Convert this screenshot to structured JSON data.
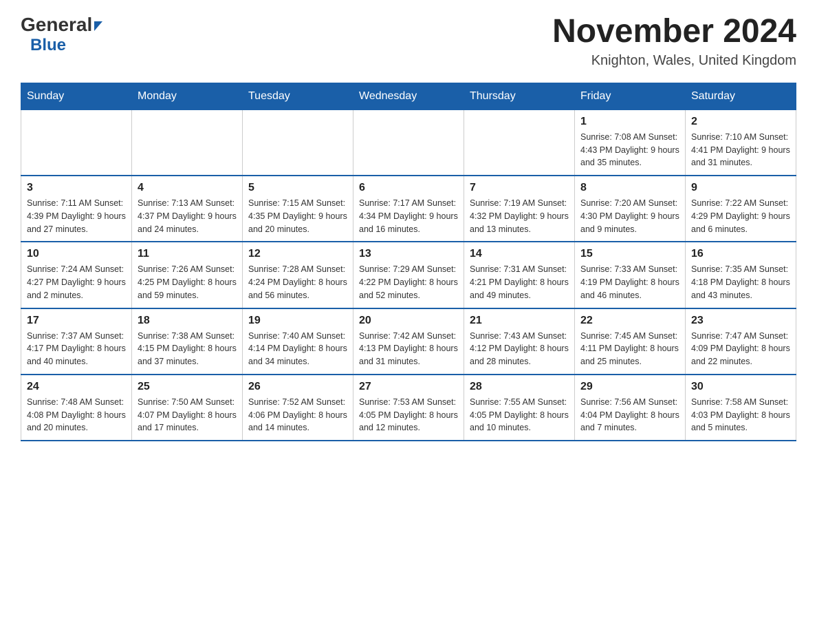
{
  "header": {
    "logo_general": "General",
    "logo_blue": "Blue",
    "month_title": "November 2024",
    "location": "Knighton, Wales, United Kingdom"
  },
  "days_of_week": [
    "Sunday",
    "Monday",
    "Tuesday",
    "Wednesday",
    "Thursday",
    "Friday",
    "Saturday"
  ],
  "weeks": [
    {
      "days": [
        {
          "number": "",
          "info": ""
        },
        {
          "number": "",
          "info": ""
        },
        {
          "number": "",
          "info": ""
        },
        {
          "number": "",
          "info": ""
        },
        {
          "number": "",
          "info": ""
        },
        {
          "number": "1",
          "info": "Sunrise: 7:08 AM\nSunset: 4:43 PM\nDaylight: 9 hours and 35 minutes."
        },
        {
          "number": "2",
          "info": "Sunrise: 7:10 AM\nSunset: 4:41 PM\nDaylight: 9 hours and 31 minutes."
        }
      ]
    },
    {
      "days": [
        {
          "number": "3",
          "info": "Sunrise: 7:11 AM\nSunset: 4:39 PM\nDaylight: 9 hours and 27 minutes."
        },
        {
          "number": "4",
          "info": "Sunrise: 7:13 AM\nSunset: 4:37 PM\nDaylight: 9 hours and 24 minutes."
        },
        {
          "number": "5",
          "info": "Sunrise: 7:15 AM\nSunset: 4:35 PM\nDaylight: 9 hours and 20 minutes."
        },
        {
          "number": "6",
          "info": "Sunrise: 7:17 AM\nSunset: 4:34 PM\nDaylight: 9 hours and 16 minutes."
        },
        {
          "number": "7",
          "info": "Sunrise: 7:19 AM\nSunset: 4:32 PM\nDaylight: 9 hours and 13 minutes."
        },
        {
          "number": "8",
          "info": "Sunrise: 7:20 AM\nSunset: 4:30 PM\nDaylight: 9 hours and 9 minutes."
        },
        {
          "number": "9",
          "info": "Sunrise: 7:22 AM\nSunset: 4:29 PM\nDaylight: 9 hours and 6 minutes."
        }
      ]
    },
    {
      "days": [
        {
          "number": "10",
          "info": "Sunrise: 7:24 AM\nSunset: 4:27 PM\nDaylight: 9 hours and 2 minutes."
        },
        {
          "number": "11",
          "info": "Sunrise: 7:26 AM\nSunset: 4:25 PM\nDaylight: 8 hours and 59 minutes."
        },
        {
          "number": "12",
          "info": "Sunrise: 7:28 AM\nSunset: 4:24 PM\nDaylight: 8 hours and 56 minutes."
        },
        {
          "number": "13",
          "info": "Sunrise: 7:29 AM\nSunset: 4:22 PM\nDaylight: 8 hours and 52 minutes."
        },
        {
          "number": "14",
          "info": "Sunrise: 7:31 AM\nSunset: 4:21 PM\nDaylight: 8 hours and 49 minutes."
        },
        {
          "number": "15",
          "info": "Sunrise: 7:33 AM\nSunset: 4:19 PM\nDaylight: 8 hours and 46 minutes."
        },
        {
          "number": "16",
          "info": "Sunrise: 7:35 AM\nSunset: 4:18 PM\nDaylight: 8 hours and 43 minutes."
        }
      ]
    },
    {
      "days": [
        {
          "number": "17",
          "info": "Sunrise: 7:37 AM\nSunset: 4:17 PM\nDaylight: 8 hours and 40 minutes."
        },
        {
          "number": "18",
          "info": "Sunrise: 7:38 AM\nSunset: 4:15 PM\nDaylight: 8 hours and 37 minutes."
        },
        {
          "number": "19",
          "info": "Sunrise: 7:40 AM\nSunset: 4:14 PM\nDaylight: 8 hours and 34 minutes."
        },
        {
          "number": "20",
          "info": "Sunrise: 7:42 AM\nSunset: 4:13 PM\nDaylight: 8 hours and 31 minutes."
        },
        {
          "number": "21",
          "info": "Sunrise: 7:43 AM\nSunset: 4:12 PM\nDaylight: 8 hours and 28 minutes."
        },
        {
          "number": "22",
          "info": "Sunrise: 7:45 AM\nSunset: 4:11 PM\nDaylight: 8 hours and 25 minutes."
        },
        {
          "number": "23",
          "info": "Sunrise: 7:47 AM\nSunset: 4:09 PM\nDaylight: 8 hours and 22 minutes."
        }
      ]
    },
    {
      "days": [
        {
          "number": "24",
          "info": "Sunrise: 7:48 AM\nSunset: 4:08 PM\nDaylight: 8 hours and 20 minutes."
        },
        {
          "number": "25",
          "info": "Sunrise: 7:50 AM\nSunset: 4:07 PM\nDaylight: 8 hours and 17 minutes."
        },
        {
          "number": "26",
          "info": "Sunrise: 7:52 AM\nSunset: 4:06 PM\nDaylight: 8 hours and 14 minutes."
        },
        {
          "number": "27",
          "info": "Sunrise: 7:53 AM\nSunset: 4:05 PM\nDaylight: 8 hours and 12 minutes."
        },
        {
          "number": "28",
          "info": "Sunrise: 7:55 AM\nSunset: 4:05 PM\nDaylight: 8 hours and 10 minutes."
        },
        {
          "number": "29",
          "info": "Sunrise: 7:56 AM\nSunset: 4:04 PM\nDaylight: 8 hours and 7 minutes."
        },
        {
          "number": "30",
          "info": "Sunrise: 7:58 AM\nSunset: 4:03 PM\nDaylight: 8 hours and 5 minutes."
        }
      ]
    }
  ]
}
